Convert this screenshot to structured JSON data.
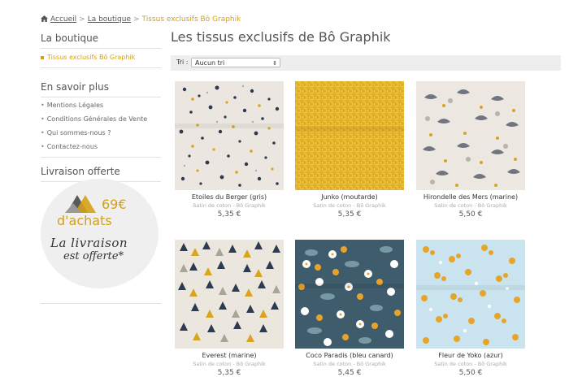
{
  "breadcrumb": {
    "home": "Accueil",
    "boutique": "La boutique",
    "current": "Tissus exclusifs Bô Graphik",
    "separator": ">"
  },
  "sidebar": {
    "shop_heading": "La boutique",
    "shop_link": "Tissus exclusifs Bô Graphik",
    "info_heading": "En savoir plus",
    "info_links": [
      "Mentions Légales",
      "Conditions Générales de Vente",
      "Qui sommes-nous ?",
      "Contactez-nous"
    ],
    "shipping_heading": "Livraison offerte",
    "promo_amount": "69€",
    "promo_achats": "d'achats",
    "promo_line1": "La livraison",
    "promo_line2": "est offerte*"
  },
  "main": {
    "title": "Les tissus exclusifs de Bô Graphik",
    "sort_label": "Tri :",
    "sort_value": "Aucun tri"
  },
  "products": [
    {
      "name": "Etoiles du Berger (gris)",
      "subtitle": "Satin de coton - Bô Graphik",
      "price": "5,35 €",
      "pattern": "stars"
    },
    {
      "name": "Junko (moutarde)",
      "subtitle": "Satin de coton - Bô Graphik",
      "price": "5,35 €",
      "pattern": "mustard"
    },
    {
      "name": "Hirondelle des Mers (marine)",
      "subtitle": "Satin de coton - Bô Graphik",
      "price": "5,50 €",
      "pattern": "birds"
    },
    {
      "name": "Everest (marine)",
      "subtitle": "Satin de coton - Bô Graphik",
      "price": "5,35 €",
      "pattern": "triangles"
    },
    {
      "name": "Coco Paradis (bleu canard)",
      "subtitle": "Satin de coton - Bô Graphik",
      "price": "5,45 €",
      "pattern": "flowers-dark"
    },
    {
      "name": "Fleur de Yoko (azur)",
      "subtitle": "Satin de coton - Bô Graphik",
      "price": "5,50 €",
      "pattern": "flowers-light"
    }
  ],
  "colors": {
    "accent": "#d4a017",
    "mustard": "#e2b021",
    "navy": "#2e3a4f",
    "teal": "#3e5c6b",
    "azure": "#c9e4ee"
  }
}
